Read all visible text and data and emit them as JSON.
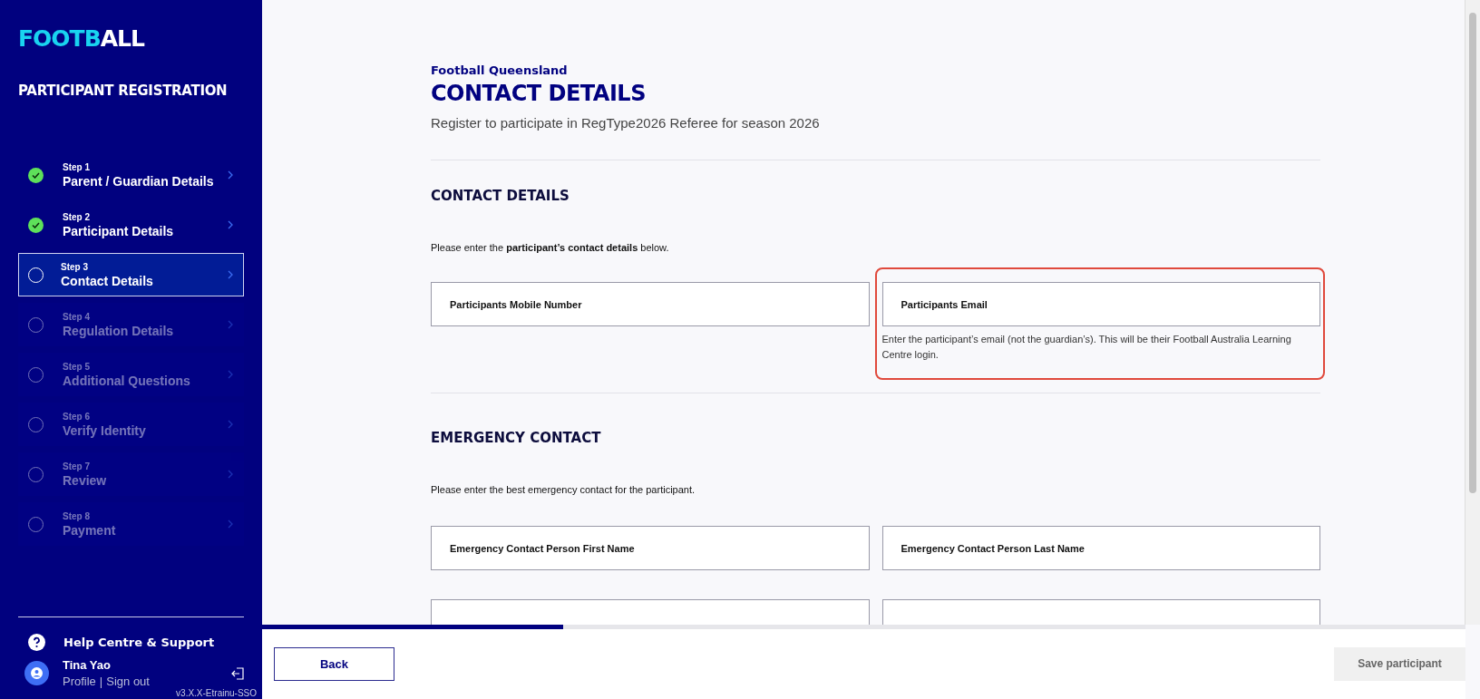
{
  "sidebar": {
    "logo": {
      "highlight": "FOOTB",
      "rest": "ALL"
    },
    "title": "PARTICIPANT REGISTRATION",
    "steps": [
      {
        "step": "Step 1",
        "label": "Parent / Guardian Details",
        "completed": true,
        "selected": false,
        "disabled": false
      },
      {
        "step": "Step 2",
        "label": "Participant Details",
        "completed": true,
        "selected": false,
        "disabled": false
      },
      {
        "step": "Step 3",
        "label": "Contact Details",
        "completed": false,
        "selected": true,
        "disabled": false
      },
      {
        "step": "Step 4",
        "label": "Regulation Details",
        "completed": false,
        "selected": false,
        "disabled": true
      },
      {
        "step": "Step 5",
        "label": "Additional Questions",
        "completed": false,
        "selected": false,
        "disabled": true
      },
      {
        "step": "Step 6",
        "label": "Verify Identity",
        "completed": false,
        "selected": false,
        "disabled": true
      },
      {
        "step": "Step 7",
        "label": "Review",
        "completed": false,
        "selected": false,
        "disabled": true
      },
      {
        "step": "Step 8",
        "label": "Payment",
        "completed": false,
        "selected": false,
        "disabled": true
      }
    ],
    "help": "Help Centre & Support",
    "user": {
      "name": "Tina Yao",
      "profile": "Profile",
      "separator": "|",
      "sign_out": "Sign out"
    },
    "version": "v3.X.X-Etrainu-SSO"
  },
  "header": {
    "organisation": "Football Queensland",
    "title": "CONTACT DETAILS",
    "subtitle": "Register to participate in RegType2026 Referee for season 2026"
  },
  "sections": [
    {
      "title": "CONTACT DETAILS",
      "intro": "Please enter the **participant’s contact details** below.",
      "fields": [
        {
          "kind": "input",
          "placeholder": "Participants Mobile Number"
        },
        {
          "kind": "input",
          "placeholder": "Participants Email",
          "hint": "Enter the participant’s email (not the guardian’s). This will be their Football Australia Learning Centre login.",
          "highlighted": true
        }
      ]
    },
    {
      "title": "EMERGENCY CONTACT",
      "intro": "Please enter the best emergency contact for the participant.",
      "fields": [
        {
          "kind": "input",
          "placeholder": "Emergency Contact Person First Name"
        },
        {
          "kind": "input",
          "placeholder": "Emergency Contact Person Last Name"
        },
        {
          "kind": "input"
        },
        {
          "kind": "input"
        }
      ]
    }
  ],
  "footer": {
    "progress": {
      "level": 0.25
    },
    "back": "Back",
    "save": {
      "label": "Save participant",
      "disabled": true
    }
  }
}
